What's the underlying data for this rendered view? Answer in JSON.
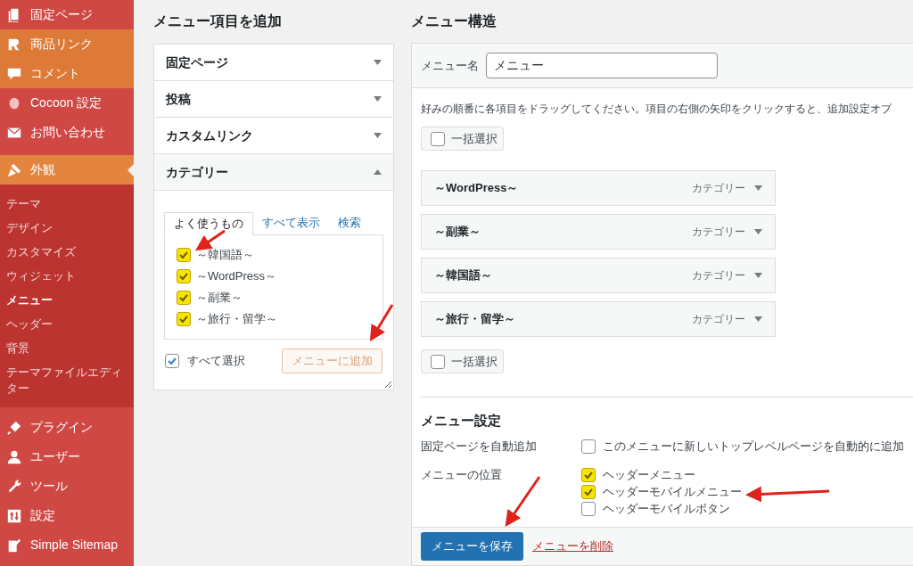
{
  "sidebar": {
    "items_top": [
      {
        "label": "固定ページ",
        "highlighted": false
      },
      {
        "label": "商品リンク",
        "highlighted": true
      },
      {
        "label": "コメント",
        "highlighted": true
      },
      {
        "label": "Cocoon 設定",
        "highlighted": false
      },
      {
        "label": "お問い合わせ",
        "highlighted": false
      }
    ],
    "current": {
      "label": "外観",
      "selected": true,
      "submenu": [
        {
          "label": "テーマ",
          "selected": false
        },
        {
          "label": "デザイン",
          "selected": false
        },
        {
          "label": "カスタマイズ",
          "selected": false
        },
        {
          "label": "ウィジェット",
          "selected": false
        },
        {
          "label": "メニュー",
          "selected": true
        },
        {
          "label": "ヘッダー",
          "selected": false
        },
        {
          "label": "背景",
          "selected": false
        },
        {
          "label": "テーマファイルエディター",
          "selected": false
        }
      ]
    },
    "items_bottom": [
      {
        "label": "プラグイン",
        "highlighted": false
      },
      {
        "label": "ユーザー",
        "highlighted": false
      },
      {
        "label": "ツール",
        "highlighted": false
      },
      {
        "label": "設定",
        "highlighted": false
      },
      {
        "label": "Simple Sitemap",
        "highlighted": false
      }
    ]
  },
  "add_items": {
    "heading": "メニュー項目を追加",
    "sections": [
      {
        "title": "固定ページ",
        "expanded": false
      },
      {
        "title": "投稿",
        "expanded": false
      },
      {
        "title": "カスタムリンク",
        "expanded": false
      },
      {
        "title": "カテゴリー",
        "expanded": true
      }
    ],
    "tabs": [
      {
        "label": "よく使うもの",
        "selected": true
      },
      {
        "label": "すべて表示",
        "selected": false
      },
      {
        "label": "検索",
        "selected": false
      }
    ],
    "categories": [
      {
        "label": "～韓国語～",
        "checked": true,
        "highlighted": true
      },
      {
        "label": "～WordPress～",
        "checked": true,
        "highlighted": true
      },
      {
        "label": "～副業～",
        "checked": true,
        "highlighted": true
      },
      {
        "label": "～旅行・留学～",
        "checked": true,
        "highlighted": true
      }
    ],
    "select_all": {
      "label": "すべて選択",
      "checked": true
    },
    "add_button": "メニューに追加"
  },
  "structure": {
    "heading": "メニュー構造",
    "name_label": "メニュー名",
    "name_value": "メニュー",
    "instructions": "好みの順番に各項目をドラッグしてください。項目の右側の矢印をクリックすると、追加設定オプ",
    "bulk_select": {
      "label": "一括選択",
      "checked": false
    },
    "menu_items": [
      {
        "title": "～WordPress～",
        "type": "カテゴリー"
      },
      {
        "title": "～副業～",
        "type": "カテゴリー"
      },
      {
        "title": "～韓国語～",
        "type": "カテゴリー"
      },
      {
        "title": "～旅行・留学～",
        "type": "カテゴリー"
      }
    ],
    "bulk_select_bottom": {
      "label": "一括選択",
      "checked": false
    },
    "settings": {
      "heading": "メニュー設定",
      "auto_add": {
        "label": "固定ページを自動追加",
        "option": "このメニューに新しいトップレベルページを自動的に追加",
        "checked": false
      },
      "locations": {
        "label": "メニューの位置",
        "options": [
          {
            "label": "ヘッダーメニュー",
            "checked": true,
            "highlighted": true
          },
          {
            "label": "ヘッダーモバイルメニュー",
            "checked": true,
            "highlighted": true
          },
          {
            "label": "ヘッダーモバイルボタン",
            "checked": false,
            "highlighted": false
          }
        ]
      }
    },
    "save_button": "メニューを保存",
    "delete_link": "メニューを削除"
  }
}
